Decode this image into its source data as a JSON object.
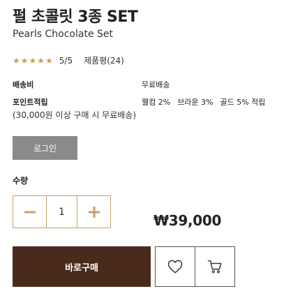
{
  "product": {
    "title": "펄 초콜릿 3종 SET",
    "subtitle": "Pearls Chocolate Set"
  },
  "rating": {
    "stars": "★★★★★",
    "score": "5/5",
    "reviews": "제품평(24)"
  },
  "shipping": {
    "label": "배송비",
    "value": "무료배송"
  },
  "points": {
    "label": "포인트적립",
    "tiers": [
      "웰컴 2%",
      "브라운 3%",
      "골드 5% 적립"
    ]
  },
  "shipping_note": "(30,000원 이상 구매 시 무료배송)",
  "login_button": "로그인",
  "quantity": {
    "label": "수량",
    "minus_icon": "minus-icon",
    "plus_icon": "plus-icon",
    "value": "1"
  },
  "price": "₩39,000",
  "actions": {
    "buy_label": "바로구매",
    "wishlist_icon": "heart-icon",
    "cart_icon": "cart-icon"
  },
  "colors": {
    "accent_gold": "#c9a063",
    "buy_brown": "#4a2b1b",
    "login_gray": "#8a8a8a"
  }
}
